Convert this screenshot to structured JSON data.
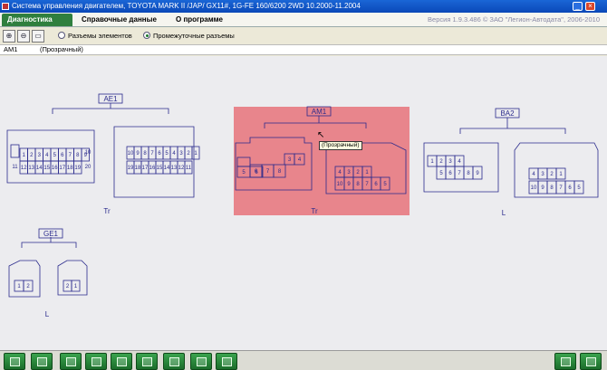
{
  "window": {
    "title": "Система управления двигателем, TOYOTA MARK II /JAP/ GX11#, 1G-FE 160/6200 2WD 10.2000-11.2004"
  },
  "tabs": [
    {
      "label": "Диагностика",
      "active": true
    },
    {
      "label": "Справочные данные",
      "active": false
    },
    {
      "label": "О программе",
      "active": false
    }
  ],
  "version_text": "Версия 1.9.3.486 © ЗАО \"Легион-Автодата\", 2006-2010",
  "toolbar": {
    "zoom_in_icon": "zoom-in-icon",
    "zoom_out_icon": "zoom-out-icon",
    "fit_icon": "fit-window-icon",
    "radio_elements": "Разъемы элементов",
    "radio_intermediate": "Промежуточные разъемы",
    "selected_radio": "radio_intermediate"
  },
  "selection": {
    "connector": "AM1",
    "color": "(Прозрачный)"
  },
  "diagram": {
    "tooltip": "(Прозрачный)",
    "highlight_color": "#e8858c",
    "line_color": "#2a2a8c",
    "connectors": [
      {
        "id": "AE1",
        "label": "AE1",
        "suffix": "Tr"
      },
      {
        "id": "AM1",
        "label": "AM1",
        "suffix": "Tr",
        "highlighted": true
      },
      {
        "id": "BA2",
        "label": "BA2",
        "suffix": "L"
      },
      {
        "id": "GE1",
        "label": "GE1",
        "suffix": "L"
      }
    ],
    "ae1_left_row1": [
      "1",
      "2",
      "3",
      "4",
      "5",
      "6",
      "7",
      "8",
      "9",
      "10"
    ],
    "ae1_left_row2": [
      "11",
      "12",
      "13",
      "14",
      "15",
      "16",
      "17",
      "18",
      "19",
      "20"
    ],
    "ae1_right_row1": [
      "10",
      "9",
      "8",
      "7",
      "6",
      "5",
      "4",
      "3",
      "2",
      "1"
    ],
    "ae1_right_row2": [
      "19",
      "18",
      "17",
      "16",
      "15",
      "14",
      "13",
      "12",
      "11"
    ],
    "am1_left_top": [
      "3",
      "4"
    ],
    "am1_left_mid": [
      "6",
      "7",
      "8"
    ],
    "am1_left_bottom": [
      "5",
      "6"
    ],
    "am1_right_top": [
      "4",
      "3",
      "2",
      "1"
    ],
    "am1_right_bottom": [
      "10",
      "9",
      "8",
      "7",
      "6",
      "5"
    ],
    "ba2_left_top": [
      "1",
      "2",
      "3",
      "4"
    ],
    "ba2_left_bottom": [
      "5",
      "6",
      "7",
      "8",
      "9"
    ],
    "ba2_right_top": [
      "4",
      "3",
      "2",
      "1"
    ],
    "ba2_right_bottom": [
      "10",
      "9",
      "8",
      "7",
      "6",
      "5"
    ],
    "ge1_left": [
      "1",
      "2"
    ],
    "ge1_right": [
      "2",
      "1"
    ]
  },
  "bottom_buttons": [
    "home-icon",
    "back-icon",
    "tools-icon",
    "grid-icon",
    "signal-icon",
    "list-icon",
    "lab-icon",
    "copy-icon",
    "export-icon",
    "print-icon",
    "exit-icon"
  ]
}
